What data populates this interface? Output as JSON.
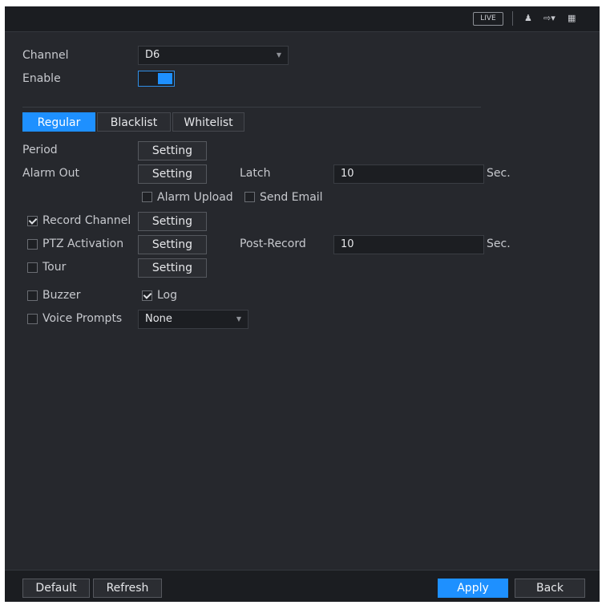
{
  "topbar": {
    "live_label": "LIVE",
    "icons": [
      "user-icon",
      "logout-icon",
      "grid-menu-icon"
    ]
  },
  "form": {
    "channel_label": "Channel",
    "channel_value": "D6",
    "enable_label": "Enable",
    "enable_on": true
  },
  "tabs": [
    {
      "label": "Regular",
      "active": true
    },
    {
      "label": "Blacklist",
      "active": false
    },
    {
      "label": "Whitelist",
      "active": false
    }
  ],
  "rows": {
    "period_label": "Period",
    "alarm_out_label": "Alarm Out",
    "latch_label": "Latch",
    "latch_value": "10",
    "latch_unit": "Sec.",
    "alarm_upload_label": "Alarm Upload",
    "send_email_label": "Send Email",
    "record_channel_label": "Record Channel",
    "ptz_activation_label": "PTZ Activation",
    "post_record_label": "Post-Record",
    "post_record_value": "10",
    "post_record_unit": "Sec.",
    "tour_label": "Tour",
    "buzzer_label": "Buzzer",
    "log_label": "Log",
    "voice_prompts_label": "Voice Prompts",
    "voice_prompts_value": "None",
    "setting_label": "Setting"
  },
  "checks": {
    "alarm_upload": false,
    "send_email": false,
    "record_channel": true,
    "ptz_activation": false,
    "tour": false,
    "buzzer": false,
    "log": true,
    "voice_prompts": false
  },
  "footer": {
    "default_label": "Default",
    "refresh_label": "Refresh",
    "apply_label": "Apply",
    "back_label": "Back"
  },
  "colors": {
    "accent": "#1e90ff",
    "panel": "#26282d"
  }
}
